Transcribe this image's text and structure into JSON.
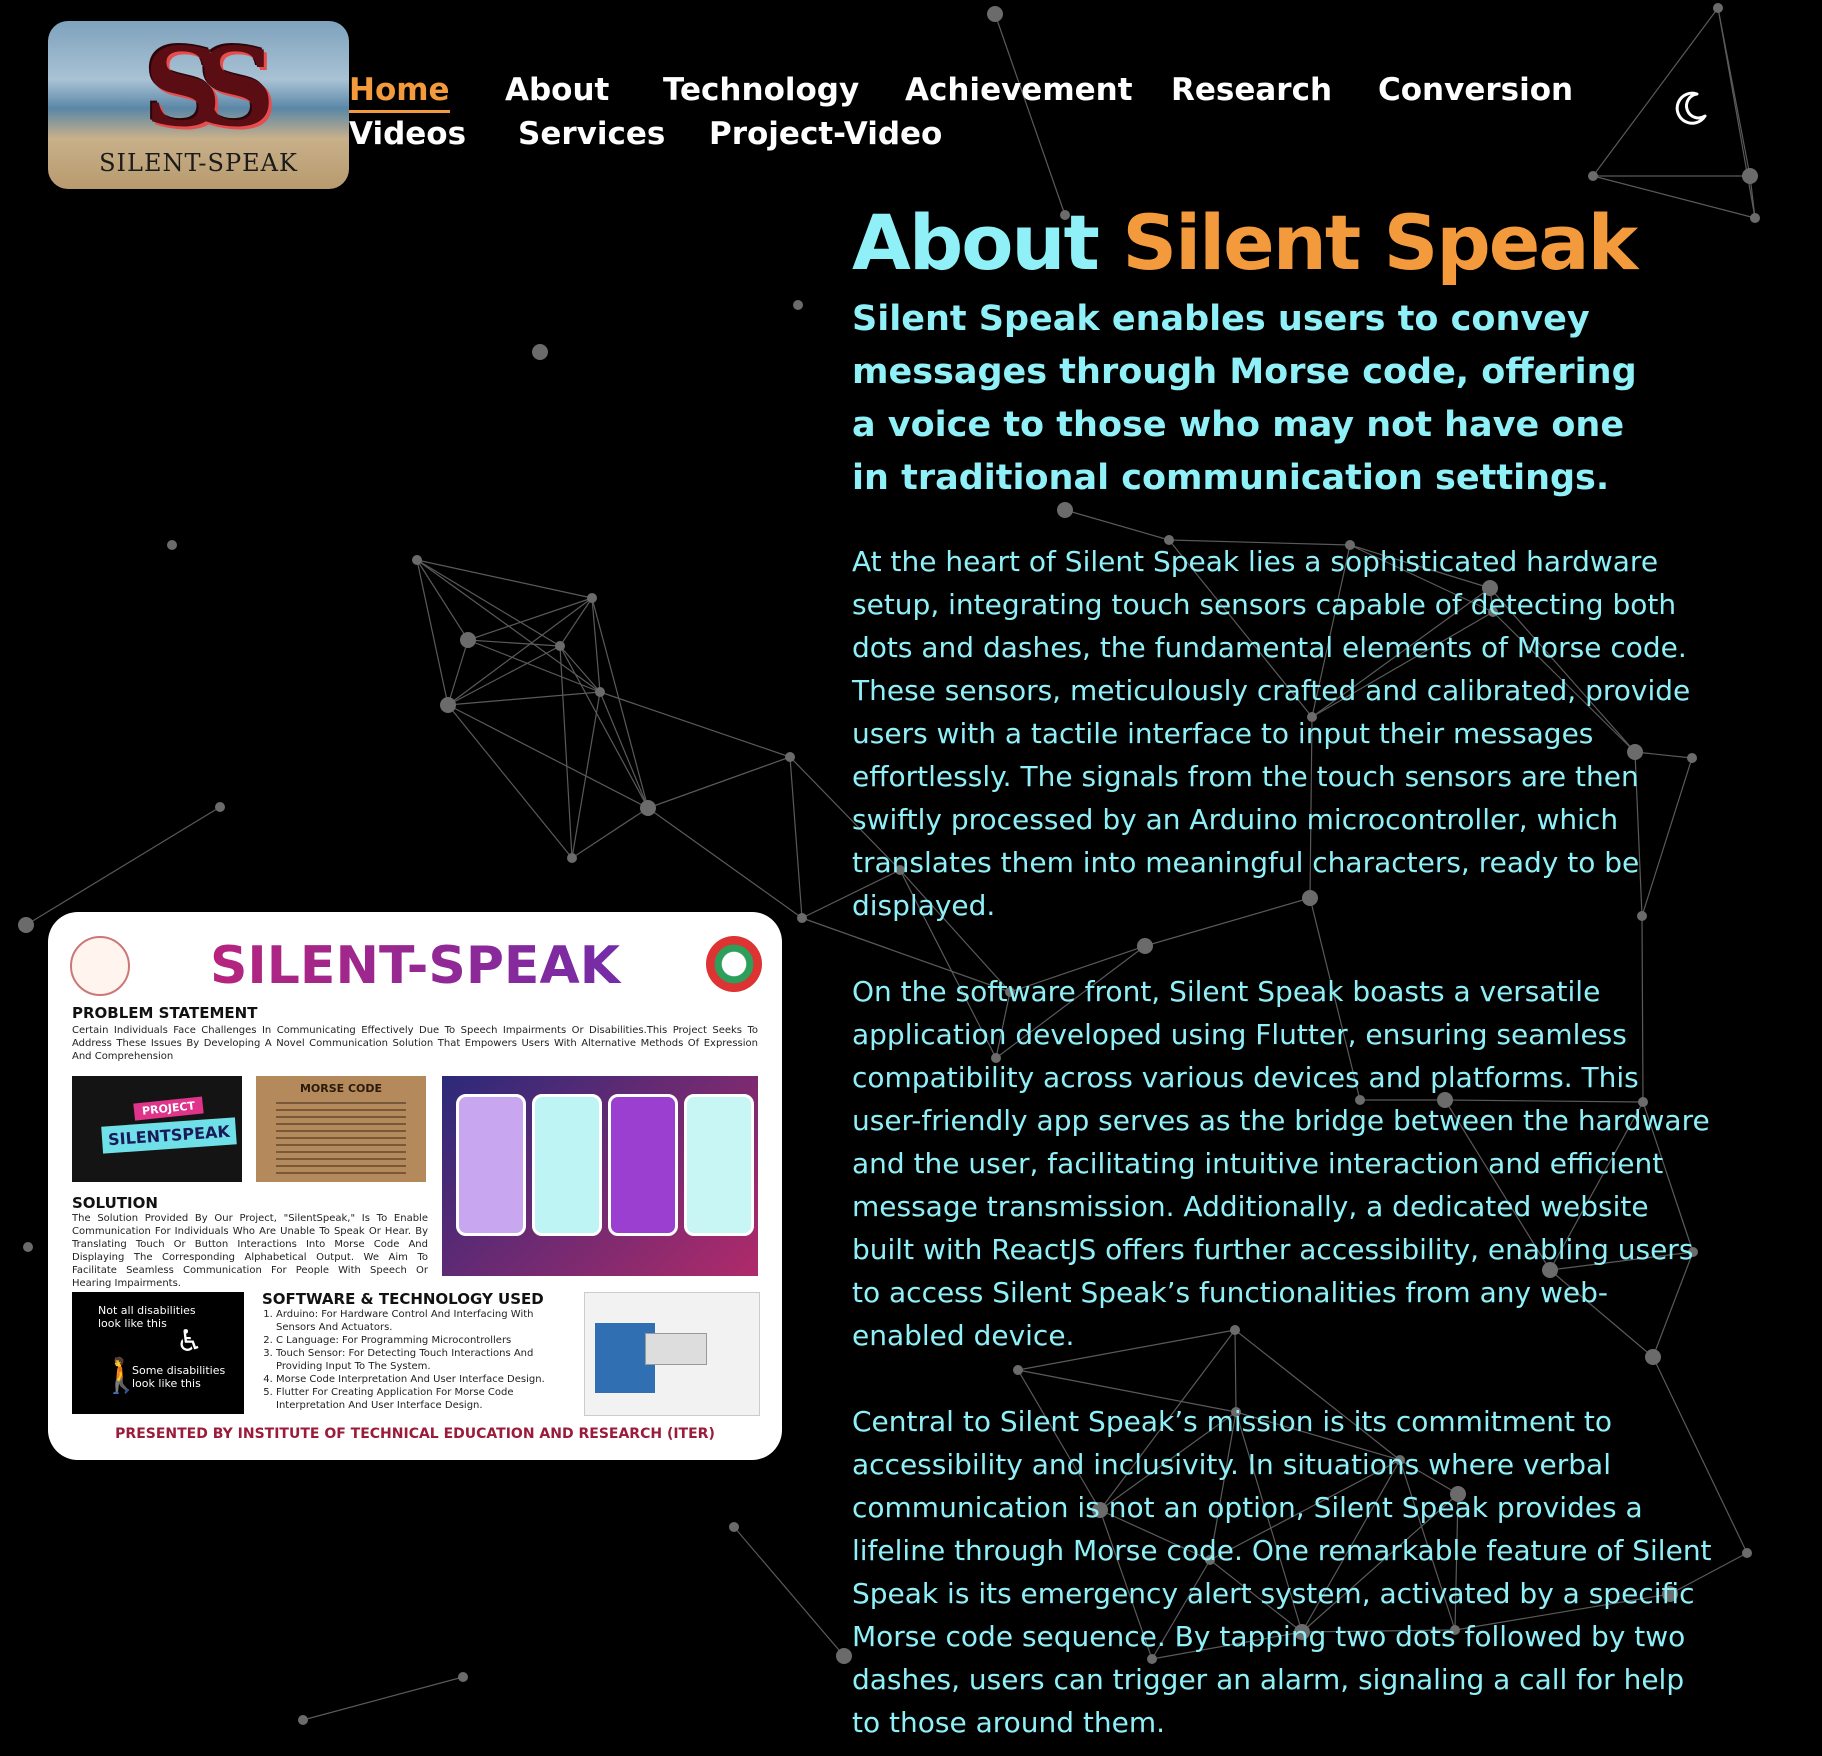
{
  "logo": {
    "mark": "SS",
    "wordmark": "SILENT-SPEAK"
  },
  "nav": {
    "items": [
      {
        "label": "Home",
        "active": true
      },
      {
        "label": "About"
      },
      {
        "label": "Technology"
      },
      {
        "label": "Achievement"
      },
      {
        "label": "Research"
      },
      {
        "label": "Conversion"
      },
      {
        "label": "Videos"
      },
      {
        "label": "Services"
      },
      {
        "label": "Project-Video"
      }
    ],
    "theme_toggle_icon": "moon-icon"
  },
  "about": {
    "title_part1": "About",
    "title_part2": "Silent Speak",
    "lead": "Silent Speak enables users to convey messages through Morse code, offering a voice to those who may not have one in traditional communication settings.",
    "paragraphs": [
      "At the heart of Silent Speak lies a sophisticated hardware setup, integrating touch sensors capable of detecting both dots and dashes, the fundamental elements of Morse code. These sensors, meticulously crafted and calibrated, provide users with a tactile interface to input their messages effortlessly. The signals from the touch sensors are then swiftly processed by an Arduino microcontroller, which translates them into meaningful characters, ready to be displayed.",
      "On the software front, Silent Speak boasts a versatile application developed using Flutter, ensuring seamless compatibility across various devices and platforms. This user-friendly app serves as the bridge between the hardware and the user, facilitating intuitive interaction and efficient message transmission. Additionally, a dedicated website built with ReactJS offers further accessibility, enabling users to access Silent Speak’s functionalities from any web-enabled device.",
      "Central to Silent Speak’s mission is its commitment to accessibility and inclusivity. In situations where verbal communication is not an option, Silent Speak provides a lifeline through Morse code. One remarkable feature of Silent Speak is its emergency alert system, activated by a specific Morse code sequence. By tapping two dots followed by two dashes, users can trigger an alarm, signaling a call for help to those around them."
    ]
  },
  "poster": {
    "title": "SILENT-SPEAK",
    "problem_heading": "PROBLEM STATEMENT",
    "problem_text": "Certain Individuals Face Challenges In Communicating Effectively Due To Speech Impairments Or Disabilities.This Project Seeks To Address These Issues By Developing A Novel Communication Solution That Empowers Users With Alternative Methods Of Expression And Comprehension",
    "badge_top": "PROJECT",
    "badge_main": "SILENTSPEAK",
    "morse_heading": "MORSE CODE",
    "solution_heading": "SOLUTION",
    "solution_text": "The Solution Provided By Our Project, \"SilentSpeak,\" Is To Enable Communication For Individuals Who Are Unable To Speak Or Hear. By Translating Touch Or Button Interactions Into Morse Code And Displaying The Corresponding Alphabetical Output. We Aim To Facilitate Seamless Communication For People With Speech Or Hearing Impairments.",
    "disab_line1": "Not all disabilities look like this",
    "disab_line2": "Some disabilities look like this",
    "tech_heading": "SOFTWARE & TECHNOLOGY USED",
    "tech_items": [
      "Arduino: For Hardware Control And Interfacing With Sensors And Actuators.",
      "C Language: For Programming Microcontrollers",
      "Touch Sensor: For Detecting Touch Interactions And Providing Input To The System.",
      "Morse Code Interpretation And User Interface Design.",
      "Flutter For Creating Application For Morse Code Interpretation And User Interface Design."
    ],
    "footer": "PRESENTED BY INSTITUTE OF TECHNICAL EDUCATION AND RESEARCH (ITER)"
  },
  "colors": {
    "accent": "#f39a3d",
    "text_cyan": "#8ff0f7",
    "background": "#000000"
  }
}
